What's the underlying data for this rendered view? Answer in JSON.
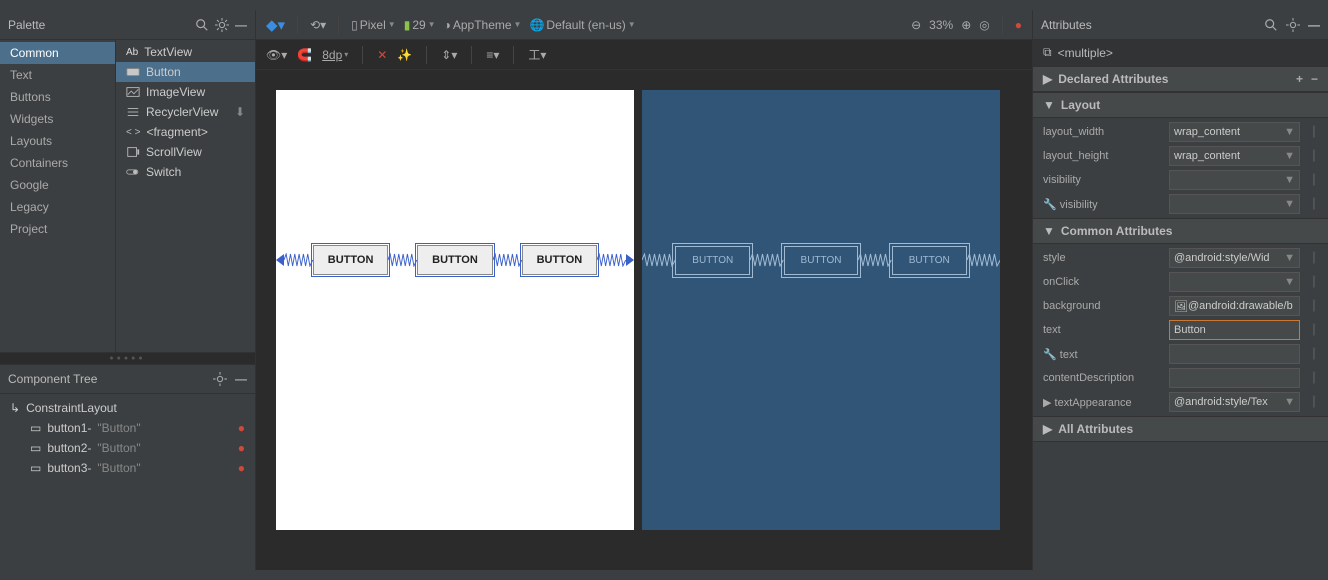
{
  "palette": {
    "title": "Palette",
    "categories": [
      "Common",
      "Text",
      "Buttons",
      "Widgets",
      "Layouts",
      "Containers",
      "Google",
      "Legacy",
      "Project"
    ],
    "selectedCategoryIndex": 0,
    "items": [
      {
        "icon": "Ab",
        "label": "TextView"
      },
      {
        "icon": "btn",
        "label": "Button"
      },
      {
        "icon": "img",
        "label": "ImageView"
      },
      {
        "icon": "list",
        "label": "RecyclerView",
        "download": true
      },
      {
        "icon": "frag",
        "label": "<fragment>"
      },
      {
        "icon": "scroll",
        "label": "ScrollView"
      },
      {
        "icon": "switch",
        "label": "Switch"
      }
    ],
    "selectedItemIndex": 1
  },
  "tree": {
    "title": "Component Tree",
    "root": {
      "label": "ConstraintLayout"
    },
    "children": [
      {
        "id": "button1",
        "text": "\"Button\""
      },
      {
        "id": "button2",
        "text": "\"Button\""
      },
      {
        "id": "button3",
        "text": "\"Button\""
      }
    ]
  },
  "toolbar": {
    "device": "Pixel",
    "api": "29",
    "theme": "AppTheme",
    "locale": "Default (en-us)",
    "zoom": "33%",
    "margin": "8dp"
  },
  "canvas": {
    "buttonLabel": "BUTTON"
  },
  "attributes": {
    "title": "Attributes",
    "selection": "<multiple>",
    "sections": {
      "declared": "Declared Attributes",
      "layout": "Layout",
      "common": "Common Attributes",
      "all": "All Attributes"
    },
    "layout": {
      "width_label": "layout_width",
      "width_value": "wrap_content",
      "height_label": "layout_height",
      "height_value": "wrap_content",
      "visibility_label": "visibility",
      "visibility_value": "",
      "tools_visibility_label": "visibility",
      "tools_visibility_value": ""
    },
    "common_attrs": {
      "style_label": "style",
      "style_value": "@android:style/Wid",
      "onclick_label": "onClick",
      "onclick_value": "",
      "background_label": "background",
      "background_value": "@android:drawable/b",
      "text_label": "text",
      "text_value": "Button",
      "tools_text_label": "text",
      "tools_text_value": "",
      "contentdesc_label": "contentDescription",
      "contentdesc_value": "",
      "textappearance_label": "textAppearance",
      "textappearance_value": "@android:style/Tex"
    }
  }
}
